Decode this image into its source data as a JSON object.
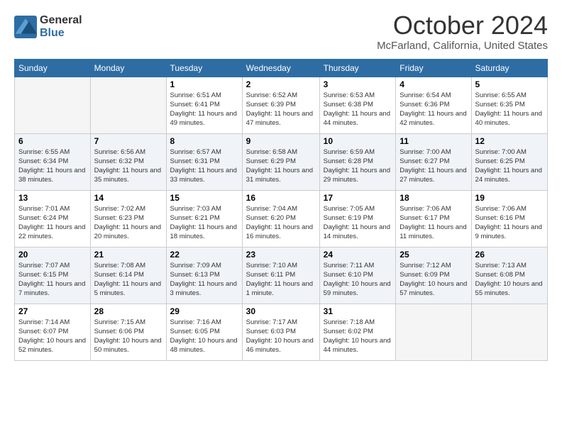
{
  "header": {
    "logo": {
      "general": "General",
      "blue": "Blue"
    },
    "title": "October 2024",
    "subtitle": "McFarland, California, United States"
  },
  "days_of_week": [
    "Sunday",
    "Monday",
    "Tuesday",
    "Wednesday",
    "Thursday",
    "Friday",
    "Saturday"
  ],
  "weeks": [
    [
      {
        "day": "",
        "info": ""
      },
      {
        "day": "",
        "info": ""
      },
      {
        "day": "1",
        "info": "Sunrise: 6:51 AM\nSunset: 6:41 PM\nDaylight: 11 hours and 49 minutes."
      },
      {
        "day": "2",
        "info": "Sunrise: 6:52 AM\nSunset: 6:39 PM\nDaylight: 11 hours and 47 minutes."
      },
      {
        "day": "3",
        "info": "Sunrise: 6:53 AM\nSunset: 6:38 PM\nDaylight: 11 hours and 44 minutes."
      },
      {
        "day": "4",
        "info": "Sunrise: 6:54 AM\nSunset: 6:36 PM\nDaylight: 11 hours and 42 minutes."
      },
      {
        "day": "5",
        "info": "Sunrise: 6:55 AM\nSunset: 6:35 PM\nDaylight: 11 hours and 40 minutes."
      }
    ],
    [
      {
        "day": "6",
        "info": "Sunrise: 6:55 AM\nSunset: 6:34 PM\nDaylight: 11 hours and 38 minutes."
      },
      {
        "day": "7",
        "info": "Sunrise: 6:56 AM\nSunset: 6:32 PM\nDaylight: 11 hours and 35 minutes."
      },
      {
        "day": "8",
        "info": "Sunrise: 6:57 AM\nSunset: 6:31 PM\nDaylight: 11 hours and 33 minutes."
      },
      {
        "day": "9",
        "info": "Sunrise: 6:58 AM\nSunset: 6:29 PM\nDaylight: 11 hours and 31 minutes."
      },
      {
        "day": "10",
        "info": "Sunrise: 6:59 AM\nSunset: 6:28 PM\nDaylight: 11 hours and 29 minutes."
      },
      {
        "day": "11",
        "info": "Sunrise: 7:00 AM\nSunset: 6:27 PM\nDaylight: 11 hours and 27 minutes."
      },
      {
        "day": "12",
        "info": "Sunrise: 7:00 AM\nSunset: 6:25 PM\nDaylight: 11 hours and 24 minutes."
      }
    ],
    [
      {
        "day": "13",
        "info": "Sunrise: 7:01 AM\nSunset: 6:24 PM\nDaylight: 11 hours and 22 minutes."
      },
      {
        "day": "14",
        "info": "Sunrise: 7:02 AM\nSunset: 6:23 PM\nDaylight: 11 hours and 20 minutes."
      },
      {
        "day": "15",
        "info": "Sunrise: 7:03 AM\nSunset: 6:21 PM\nDaylight: 11 hours and 18 minutes."
      },
      {
        "day": "16",
        "info": "Sunrise: 7:04 AM\nSunset: 6:20 PM\nDaylight: 11 hours and 16 minutes."
      },
      {
        "day": "17",
        "info": "Sunrise: 7:05 AM\nSunset: 6:19 PM\nDaylight: 11 hours and 14 minutes."
      },
      {
        "day": "18",
        "info": "Sunrise: 7:06 AM\nSunset: 6:17 PM\nDaylight: 11 hours and 11 minutes."
      },
      {
        "day": "19",
        "info": "Sunrise: 7:06 AM\nSunset: 6:16 PM\nDaylight: 11 hours and 9 minutes."
      }
    ],
    [
      {
        "day": "20",
        "info": "Sunrise: 7:07 AM\nSunset: 6:15 PM\nDaylight: 11 hours and 7 minutes."
      },
      {
        "day": "21",
        "info": "Sunrise: 7:08 AM\nSunset: 6:14 PM\nDaylight: 11 hours and 5 minutes."
      },
      {
        "day": "22",
        "info": "Sunrise: 7:09 AM\nSunset: 6:13 PM\nDaylight: 11 hours and 3 minutes."
      },
      {
        "day": "23",
        "info": "Sunrise: 7:10 AM\nSunset: 6:11 PM\nDaylight: 11 hours and 1 minute."
      },
      {
        "day": "24",
        "info": "Sunrise: 7:11 AM\nSunset: 6:10 PM\nDaylight: 10 hours and 59 minutes."
      },
      {
        "day": "25",
        "info": "Sunrise: 7:12 AM\nSunset: 6:09 PM\nDaylight: 10 hours and 57 minutes."
      },
      {
        "day": "26",
        "info": "Sunrise: 7:13 AM\nSunset: 6:08 PM\nDaylight: 10 hours and 55 minutes."
      }
    ],
    [
      {
        "day": "27",
        "info": "Sunrise: 7:14 AM\nSunset: 6:07 PM\nDaylight: 10 hours and 52 minutes."
      },
      {
        "day": "28",
        "info": "Sunrise: 7:15 AM\nSunset: 6:06 PM\nDaylight: 10 hours and 50 minutes."
      },
      {
        "day": "29",
        "info": "Sunrise: 7:16 AM\nSunset: 6:05 PM\nDaylight: 10 hours and 48 minutes."
      },
      {
        "day": "30",
        "info": "Sunrise: 7:17 AM\nSunset: 6:03 PM\nDaylight: 10 hours and 46 minutes."
      },
      {
        "day": "31",
        "info": "Sunrise: 7:18 AM\nSunset: 6:02 PM\nDaylight: 10 hours and 44 minutes."
      },
      {
        "day": "",
        "info": ""
      },
      {
        "day": "",
        "info": ""
      }
    ]
  ]
}
